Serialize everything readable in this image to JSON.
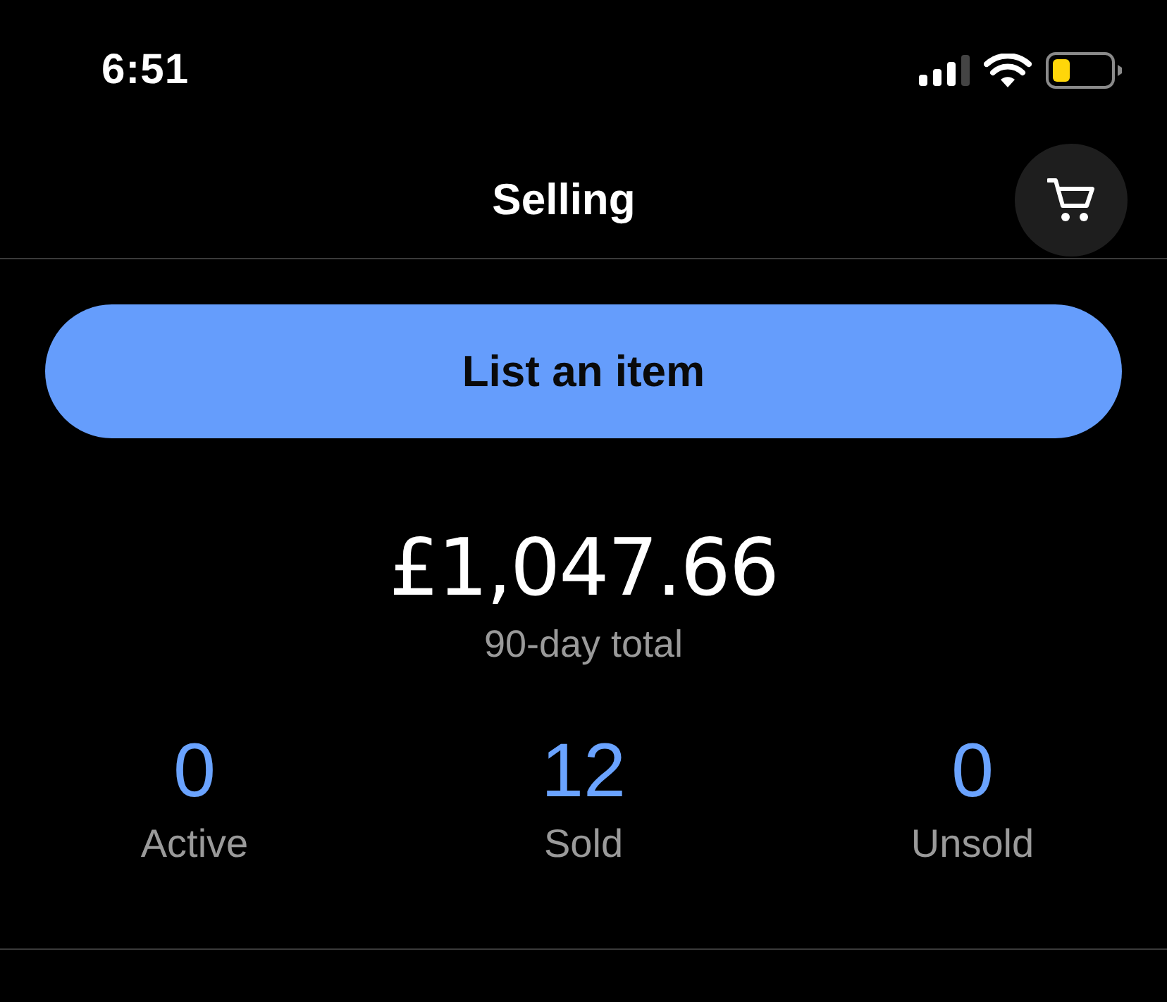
{
  "status_bar": {
    "time": "6:51"
  },
  "header": {
    "title": "Selling"
  },
  "primary_button": {
    "label": "List an item"
  },
  "summary": {
    "amount": "£1,047.66",
    "caption": "90-day total"
  },
  "stats": [
    {
      "value": "0",
      "label": "Active"
    },
    {
      "value": "12",
      "label": "Sold"
    },
    {
      "value": "0",
      "label": "Unsold"
    }
  ]
}
